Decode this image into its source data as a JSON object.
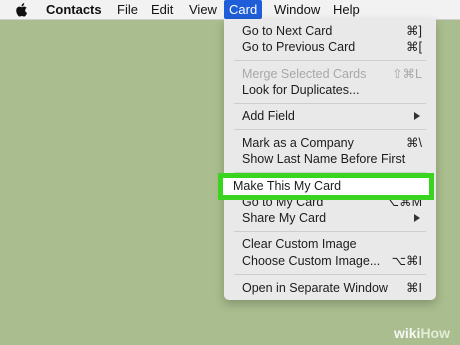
{
  "menubar": {
    "items": [
      "Contacts",
      "File",
      "Edit",
      "View",
      "Card",
      "Window",
      "Help"
    ],
    "active": "Card"
  },
  "menu": {
    "items": [
      {
        "label": "Go to Next Card",
        "shortcut": "⌘]"
      },
      {
        "label": "Go to Previous Card",
        "shortcut": "⌘["
      },
      {
        "label": "Merge Selected Cards",
        "shortcut": "⇧⌘L",
        "disabled": true
      },
      {
        "label": "Look for Duplicates..."
      },
      {
        "label": "Add Field",
        "submenu": true
      },
      {
        "label": "Mark as a Company",
        "shortcut": "⌘\\"
      },
      {
        "label": "Show Last Name Before First"
      },
      {
        "label": "Make This My Card"
      },
      {
        "label": "Go to My Card",
        "shortcut": "⌥⌘M"
      },
      {
        "label": "Share My Card",
        "submenu": true
      },
      {
        "label": "Clear Custom Image"
      },
      {
        "label": "Choose Custom Image...",
        "shortcut": "⌥⌘I"
      },
      {
        "label": "Open in Separate Window",
        "shortcut": "⌘I"
      }
    ]
  },
  "highlight": {
    "color": "#39d41f"
  },
  "watermark": {
    "text_1": "wiki",
    "text_2": "How"
  }
}
